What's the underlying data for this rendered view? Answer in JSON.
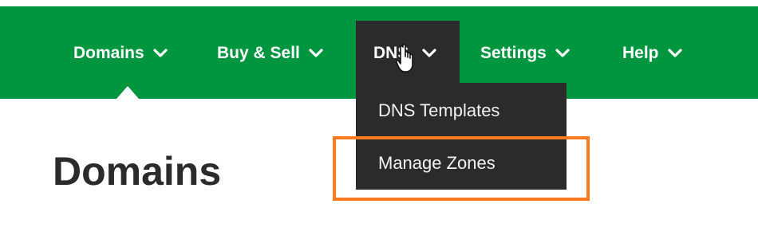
{
  "nav": {
    "items": [
      {
        "label": "Domains"
      },
      {
        "label": "Buy & Sell"
      },
      {
        "label": "DNS"
      },
      {
        "label": "Settings"
      },
      {
        "label": "Help"
      }
    ]
  },
  "dropdown": {
    "items": [
      {
        "label": "DNS Templates"
      },
      {
        "label": "Manage Zones"
      }
    ]
  },
  "page": {
    "title": "Domains"
  },
  "colors": {
    "nav_background": "#00963f",
    "active_tab": "#2b2b2b",
    "highlight": "#ff7a1f",
    "title_text": "#2b2b2b"
  },
  "icons": {
    "chevron": "chevron-down-icon",
    "cursor": "hand-pointer-cursor-icon"
  }
}
